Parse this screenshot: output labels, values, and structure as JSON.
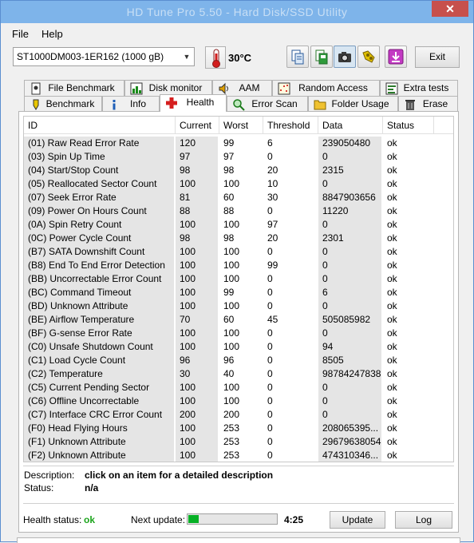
{
  "window": {
    "title": "HD Tune Pro 5.50 - Hard Disk/SSD Utility",
    "close_glyph": "✕"
  },
  "menu": {
    "file": "File",
    "help": "Help"
  },
  "toolbar": {
    "drive": "ST1000DM003-1ER162 (1000 gB)",
    "temperature": "30°C",
    "exit_label": "Exit",
    "icons": [
      "thermometer-icon",
      "copy-icon",
      "save-icon",
      "camera-icon",
      "options-icon",
      "download-icon"
    ]
  },
  "tabs_top": [
    {
      "label": "File Benchmark",
      "icon": "file-benchmark-icon"
    },
    {
      "label": "Disk monitor",
      "icon": "disk-monitor-icon"
    },
    {
      "label": "AAM",
      "icon": "speaker-icon"
    },
    {
      "label": "Random Access",
      "icon": "random-access-icon"
    },
    {
      "label": "Extra tests",
      "icon": "extra-tests-icon"
    }
  ],
  "tabs_bottom": [
    {
      "label": "Benchmark",
      "icon": "benchmark-icon"
    },
    {
      "label": "Info",
      "icon": "info-icon"
    },
    {
      "label": "Health",
      "icon": "health-cross-icon"
    },
    {
      "label": "Error Scan",
      "icon": "error-scan-icon"
    },
    {
      "label": "Folder Usage",
      "icon": "folder-icon"
    },
    {
      "label": "Erase",
      "icon": "trash-icon"
    }
  ],
  "active_tab": "Health",
  "table": {
    "headers": [
      "ID",
      "Current",
      "Worst",
      "Threshold",
      "Data",
      "Status"
    ],
    "rows": [
      [
        "(01) Raw Read Error Rate",
        "120",
        "99",
        "6",
        "239050480",
        "ok"
      ],
      [
        "(03) Spin Up Time",
        "97",
        "97",
        "0",
        "0",
        "ok"
      ],
      [
        "(04) Start/Stop Count",
        "98",
        "98",
        "20",
        "2315",
        "ok"
      ],
      [
        "(05) Reallocated Sector Count",
        "100",
        "100",
        "10",
        "0",
        "ok"
      ],
      [
        "(07) Seek Error Rate",
        "81",
        "60",
        "30",
        "8847903656",
        "ok"
      ],
      [
        "(09) Power On Hours Count",
        "88",
        "88",
        "0",
        "11220",
        "ok"
      ],
      [
        "(0A) Spin Retry Count",
        "100",
        "100",
        "97",
        "0",
        "ok"
      ],
      [
        "(0C) Power Cycle Count",
        "98",
        "98",
        "20",
        "2301",
        "ok"
      ],
      [
        "(B7) SATA Downshift Count",
        "100",
        "100",
        "0",
        "0",
        "ok"
      ],
      [
        "(B8) End To End Error Detection",
        "100",
        "100",
        "99",
        "0",
        "ok"
      ],
      [
        "(BB) Uncorrectable Error Count",
        "100",
        "100",
        "0",
        "0",
        "ok"
      ],
      [
        "(BC) Command Timeout",
        "100",
        "99",
        "0",
        "6",
        "ok"
      ],
      [
        "(BD) Unknown Attribute",
        "100",
        "100",
        "0",
        "0",
        "ok"
      ],
      [
        "(BE) Airflow Temperature",
        "70",
        "60",
        "45",
        "505085982",
        "ok"
      ],
      [
        "(BF) G-sense Error Rate",
        "100",
        "100",
        "0",
        "0",
        "ok"
      ],
      [
        "(C0) Unsafe Shutdown Count",
        "100",
        "100",
        "0",
        "94",
        "ok"
      ],
      [
        "(C1) Load Cycle Count",
        "96",
        "96",
        "0",
        "8505",
        "ok"
      ],
      [
        "(C2) Temperature",
        "30",
        "40",
        "0",
        "98784247838",
        "ok"
      ],
      [
        "(C5) Current Pending Sector",
        "100",
        "100",
        "0",
        "0",
        "ok"
      ],
      [
        "(C6) Offline Uncorrectable",
        "100",
        "100",
        "0",
        "0",
        "ok"
      ],
      [
        "(C7) Interface CRC Error Count",
        "200",
        "200",
        "0",
        "0",
        "ok"
      ],
      [
        "(F0) Head Flying Hours",
        "100",
        "253",
        "0",
        "208065395...",
        "ok"
      ],
      [
        "(F1) Unknown Attribute",
        "100",
        "253",
        "0",
        "29679638054",
        "ok"
      ],
      [
        "(F2) Unknown Attribute",
        "100",
        "253",
        "0",
        "474310346...",
        "ok"
      ]
    ]
  },
  "details": {
    "description_label": "Description:",
    "description_value": "click on an item for a detailed description",
    "status_label": "Status:",
    "status_value": "n/a"
  },
  "footer": {
    "health_label": "Health status:",
    "health_value": "ok",
    "next_update_label": "Next update:",
    "next_update_progress": 0.12,
    "next_update_time": "4:25",
    "update_button": "Update",
    "log_button": "Log"
  },
  "colors": {
    "titlebar": "#7eb4ea",
    "close": "#c7504c",
    "health_ok": "#1ca51c",
    "progress_fill": "#06b025",
    "column_shade": "#e5e5e5"
  }
}
